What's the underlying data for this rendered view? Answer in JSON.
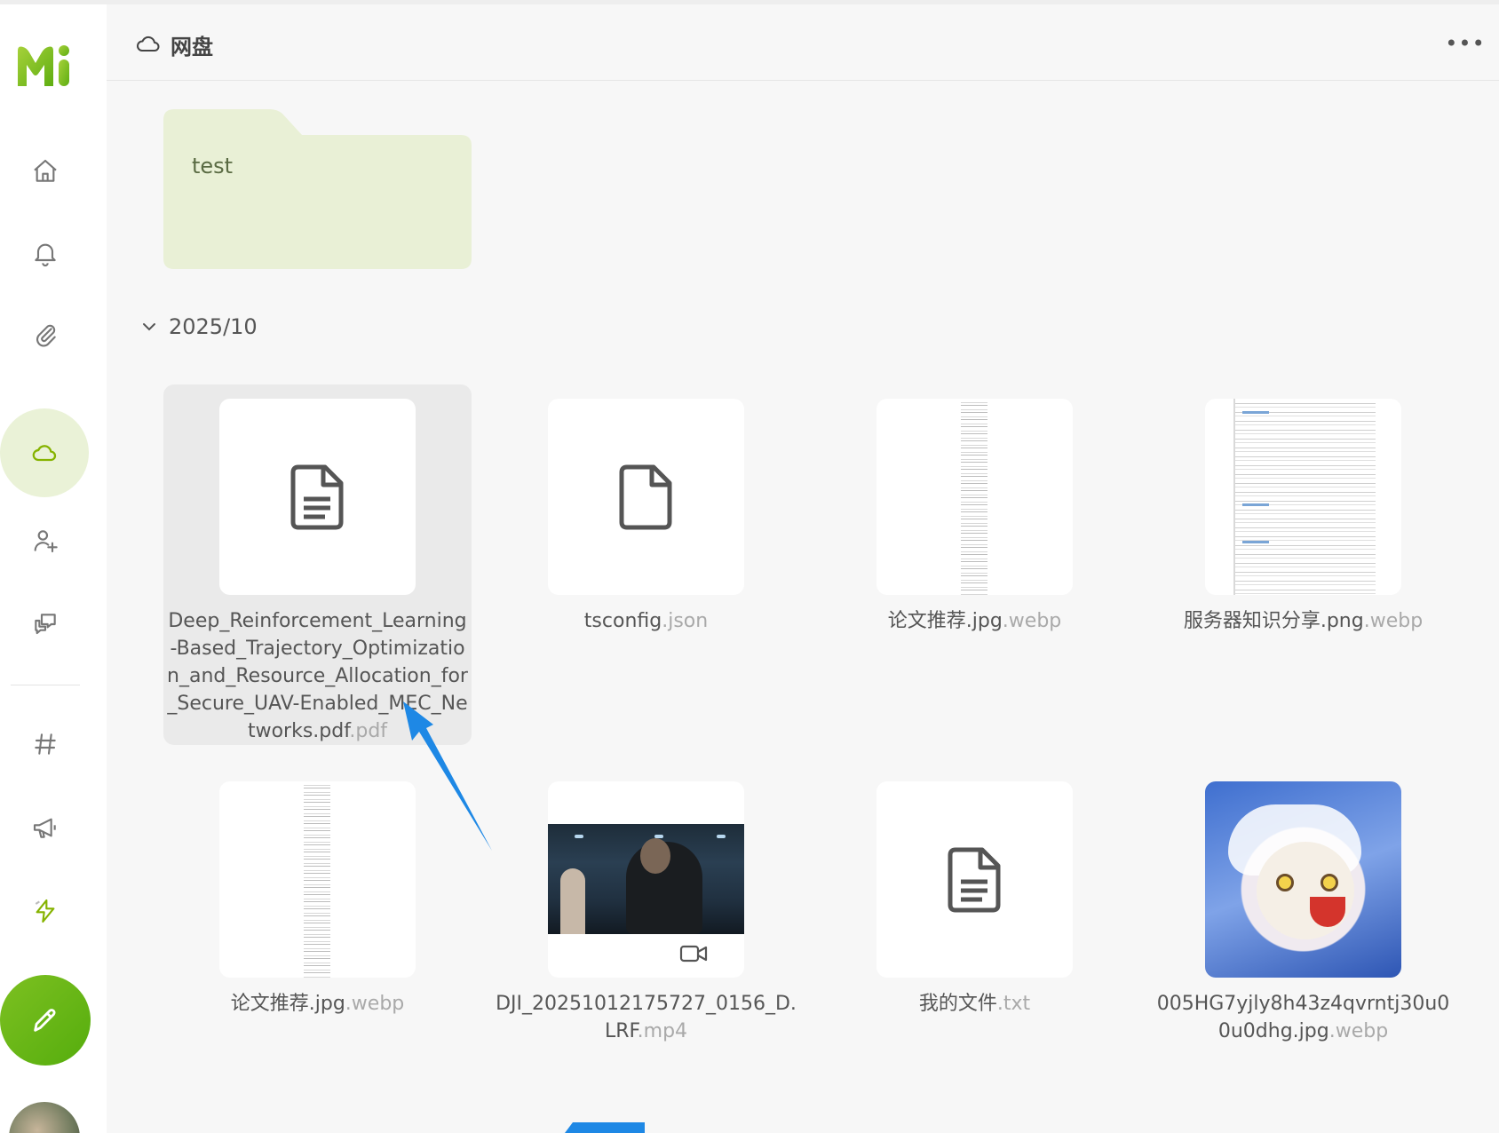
{
  "app": {
    "brand": "Mi"
  },
  "header": {
    "title": "网盘",
    "more_label": "•••"
  },
  "sidebar": {
    "items": [
      {
        "name": "home",
        "icon": "home-icon"
      },
      {
        "name": "notifications",
        "icon": "bell-icon"
      },
      {
        "name": "attachments",
        "icon": "paperclip-icon"
      },
      {
        "name": "drive",
        "icon": "cloud-icon",
        "active": true
      },
      {
        "name": "follow-requests",
        "icon": "user-plus-icon"
      },
      {
        "name": "chats",
        "icon": "chat-icon"
      },
      {
        "name": "hashtags",
        "icon": "hash-icon"
      },
      {
        "name": "announcements",
        "icon": "megaphone-icon"
      },
      {
        "name": "lightning",
        "icon": "bolt-icon"
      }
    ],
    "compose_icon": "pencil-icon"
  },
  "folder": {
    "name": "test"
  },
  "group": {
    "label": "2025/10"
  },
  "files": [
    {
      "base": "Deep_Reinforcement_Learning-Based_Trajectory_Optimization_and_Resource_Allocation_for_Secure_UAV-Enabled_MEC_Networks.pdf",
      "ext": ".pdf",
      "thumb": "doc-icon"
    },
    {
      "base": "tsconfig",
      "ext": ".json",
      "thumb": "file-icon"
    },
    {
      "base": "论文推荐.jpg",
      "ext": ".webp",
      "thumb": "doc-strip"
    },
    {
      "base": "服务器知识分享.png",
      "ext": ".webp",
      "thumb": "doc-page"
    },
    {
      "base": "论文推荐.jpg",
      "ext": ".webp",
      "thumb": "doc-strip"
    },
    {
      "base": "DJI_20251012175727_0156_D.LRF",
      "ext": ".mp4",
      "thumb": "video"
    },
    {
      "base": "我的文件",
      "ext": ".txt",
      "thumb": "doc-icon"
    },
    {
      "base": "005HG7yjly8h43z4qvrntj30u00u0dhg.jpg",
      "ext": ".webp",
      "thumb": "image"
    }
  ],
  "colors": {
    "accent": "#86b300",
    "active_bg": "#eaf2d7",
    "folder_bg": "#e9f0d6",
    "annotation_arrow": "#1e88e5"
  }
}
